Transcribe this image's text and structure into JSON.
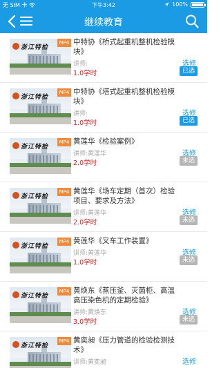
{
  "status_bar": {
    "carrier": "无 SIM 卡",
    "time": "下午3:42",
    "battery_percent": "100%",
    "battery_level": 1.0
  },
  "nav": {
    "title": "继续教育",
    "back_icon": "back-arrow",
    "menu_icon": "list-menu",
    "search_icon": "magnifier"
  },
  "colors": {
    "primary": "#1b9be3",
    "hours_red": "#e02020",
    "badge_orange": "#f08a3a",
    "unselected_gray": "#b6b6b6"
  },
  "thumbnail": {
    "badge": "MP4",
    "brand_text": "浙江特检"
  },
  "courses": [
    {
      "title": "中特协《桥式起重机整机检验模块》",
      "teacher": "讲师:",
      "hours": "1.0学时",
      "action": "选修",
      "status": "已选",
      "selected": true
    },
    {
      "title": "中特协《塔式起重机整机检验模块》",
      "teacher": "讲师:",
      "hours": "1.0学时",
      "action": "选修",
      "status": "已选",
      "selected": true
    },
    {
      "title": "黄莲华《检验案例》",
      "teacher": "讲师:黄莲华",
      "hours": "2.0学时",
      "action": "选修",
      "status": "未选",
      "selected": false
    },
    {
      "title": "黄莲华《场车定期（首次）检验项目、要求及方法》",
      "teacher": "讲师:黄莲华",
      "hours": "2.0学时",
      "action": "选修",
      "status": "未选",
      "selected": false
    },
    {
      "title": "黄莲华《叉车工作装置》",
      "teacher": "讲师:黄莲华",
      "hours": "1.0学时",
      "action": "选修",
      "status": "未选",
      "selected": false
    },
    {
      "title": "黄焕东《蒸压釜、灭菌柜、高温高压染色机的定期检验》",
      "teacher": "讲师:黄焕东",
      "hours": "3.0学时",
      "action": "选修",
      "status": "未选",
      "selected": false
    },
    {
      "title": "黄奕昶《压力管道的检验检测技术》",
      "teacher": "讲师:黄奕昶",
      "hours": "",
      "action": "选修",
      "status": "",
      "selected": false
    }
  ]
}
